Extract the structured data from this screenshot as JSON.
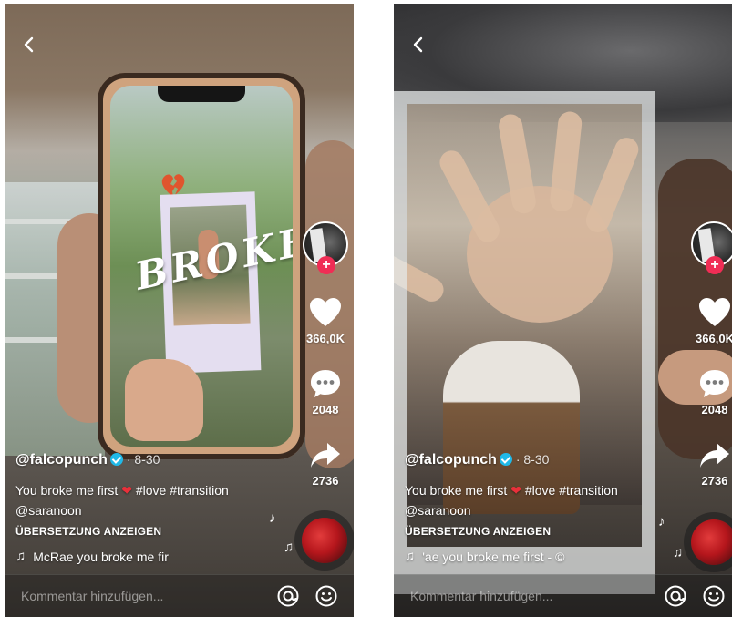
{
  "colors": {
    "like": "#ffffff",
    "follow_badge": "#f02d55",
    "verified": "#20b9e8"
  },
  "left_panel": {
    "overlay_text": "BROKE",
    "likes": "366,0K",
    "comments": "2048",
    "shares": "2736",
    "username": "@falcopunch",
    "date": "· 8-30",
    "caption_text": "You broke me first",
    "caption_tags": "#love #transition",
    "mention": "@saranoon",
    "translate_label": "ÜBERSETZUNG ANZEIGEN",
    "music_text": "McRae   you broke me fir",
    "comment_placeholder": "Kommentar hinzufügen..."
  },
  "right_panel": {
    "likes": "366,0K",
    "comments": "2048",
    "shares": "2736",
    "username": "@falcopunch",
    "date": "· 8-30",
    "caption_text": "You broke me first",
    "caption_tags": "#love #transition",
    "mention": "@saranoon",
    "translate_label": "ÜBERSETZUNG ANZEIGEN",
    "music_text": "'ae    you broke me first - ©",
    "comment_placeholder": "Kommentar hinzufügen..."
  }
}
